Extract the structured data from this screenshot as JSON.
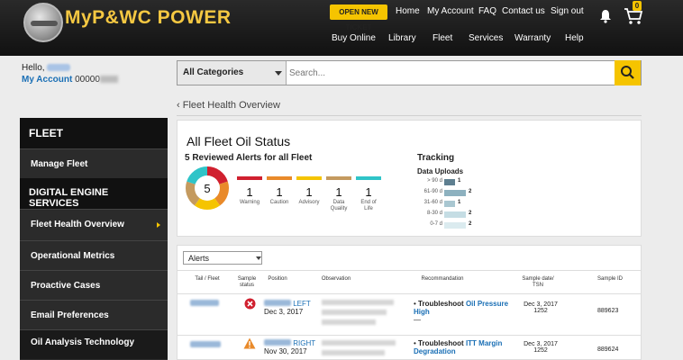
{
  "header": {
    "logo_text": "MyP&WC POWER",
    "ticket_button": "OPEN NEW TICKET",
    "top_links": [
      "Home",
      "My Account",
      "FAQ",
      "Contact us",
      "Sign out"
    ],
    "nav_links": [
      "Buy Online",
      "Library",
      "Fleet",
      "Services",
      "Warranty",
      "Help"
    ],
    "cart_count": "0"
  },
  "account": {
    "hello": "Hello,",
    "my_account_label": "My Account",
    "account_number": "00000"
  },
  "search": {
    "category": "All Categories",
    "placeholder": "Search..."
  },
  "breadcrumb": "Fleet Health Overview",
  "sidebar": {
    "sections": [
      {
        "heading": "FLEET",
        "items": [
          "Manage Fleet"
        ]
      },
      {
        "heading": "DIGITAL ENGINE SERVICES",
        "items": [
          "Fleet Health Overview",
          "Operational Metrics",
          "Proactive Cases",
          "Email Preferences",
          "Oil Analysis Technology"
        ]
      }
    ]
  },
  "oil_status": {
    "title": "All Fleet Oil Status",
    "subtitle": "5 Reviewed Alerts for all Fleet",
    "total": "5",
    "categories": [
      {
        "label": "Warning",
        "count": "1",
        "color": "#d0202f"
      },
      {
        "label": "Caution",
        "count": "1",
        "color": "#e98a2a"
      },
      {
        "label": "Advisory",
        "count": "1",
        "color": "#f5c400"
      },
      {
        "label": "Data Quality",
        "count": "1",
        "color": "#c49a5f"
      },
      {
        "label": "End of Life",
        "count": "1",
        "color": "#2fc4c8"
      }
    ]
  },
  "tracking": {
    "title": "Tracking",
    "subtitle": "Data Uploads",
    "rows": [
      {
        "range": "> 90 d",
        "value": 1,
        "label": "1",
        "color": "#5e7f90"
      },
      {
        "range": "61-90 d",
        "value": 2,
        "label": "2",
        "color": "#8db1bf"
      },
      {
        "range": "31-60 d",
        "value": 1,
        "label": "1",
        "color": "#a9c7d1"
      },
      {
        "range": "8-30 d",
        "value": 2,
        "label": "2",
        "color": "#c5dde4"
      },
      {
        "range": "0-7 d",
        "value": 2,
        "label": "2",
        "color": "#dbebef"
      }
    ]
  },
  "alerts": {
    "filter": "Alerts",
    "columns": [
      "Tail / Fleet",
      "Sample status",
      "Position",
      "Observation",
      "Recommandation",
      "Sample date/ TSN",
      "Sample ID"
    ],
    "rows": [
      {
        "status": "error",
        "position": "LEFT",
        "date": "Dec 3, 2017",
        "rec_prefix": "Troubleshoot",
        "rec_link": "Oil Pressure High",
        "rec_tail": "—",
        "sample_date": "Dec 3, 2017",
        "tsn": "1252",
        "sample_id": "889623"
      },
      {
        "status": "warning",
        "position": "RIGHT",
        "date": "Nov 30, 2017",
        "rec_prefix": "Troubleshoot",
        "rec_link": "ITT Margin Degradation",
        "rec_tail": "",
        "sample_date": "Dec 3, 2017",
        "tsn": "1252",
        "sample_id": "889624"
      }
    ]
  }
}
